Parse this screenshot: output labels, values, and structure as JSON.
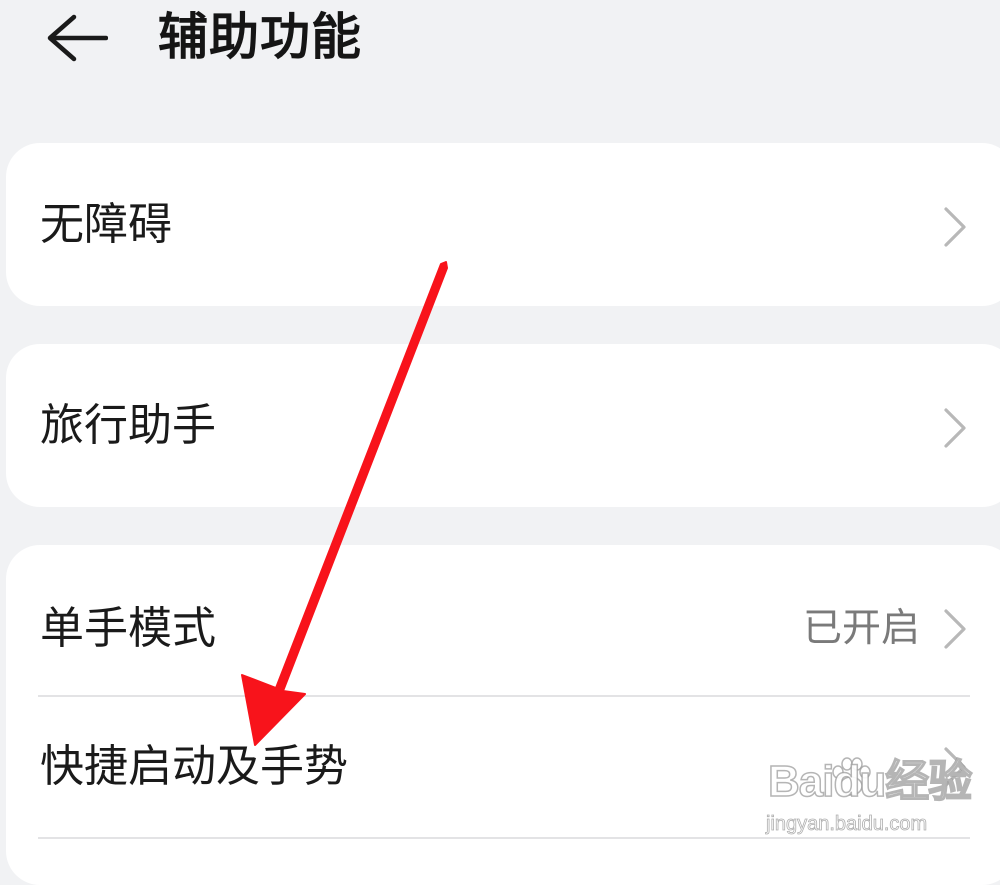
{
  "header": {
    "back_icon": "arrow-left-icon",
    "title": "辅助功能"
  },
  "cards": [
    {
      "rows": [
        {
          "label": "无障碍",
          "icon": "chevron-right-icon"
        }
      ]
    },
    {
      "rows": [
        {
          "label": "旅行助手",
          "icon": "chevron-right-icon"
        }
      ]
    },
    {
      "rows": [
        {
          "label": "单手模式",
          "value": "已开启",
          "icon": "chevron-right-icon"
        },
        {
          "label": "快捷启动及手势",
          "icon": "chevron-right-icon"
        }
      ]
    }
  ],
  "annotation": {
    "type": "red-arrow",
    "points_to": "快捷启动及手势",
    "color": "#f8131b"
  },
  "watermark": {
    "brand": "Baidu经验",
    "url": "jingyan.baidu.com"
  },
  "colors": {
    "background": "#f1f2f4",
    "card": "#ffffff",
    "secondary_text": "#7a7a7a",
    "chevron": "#b8b8b8"
  }
}
